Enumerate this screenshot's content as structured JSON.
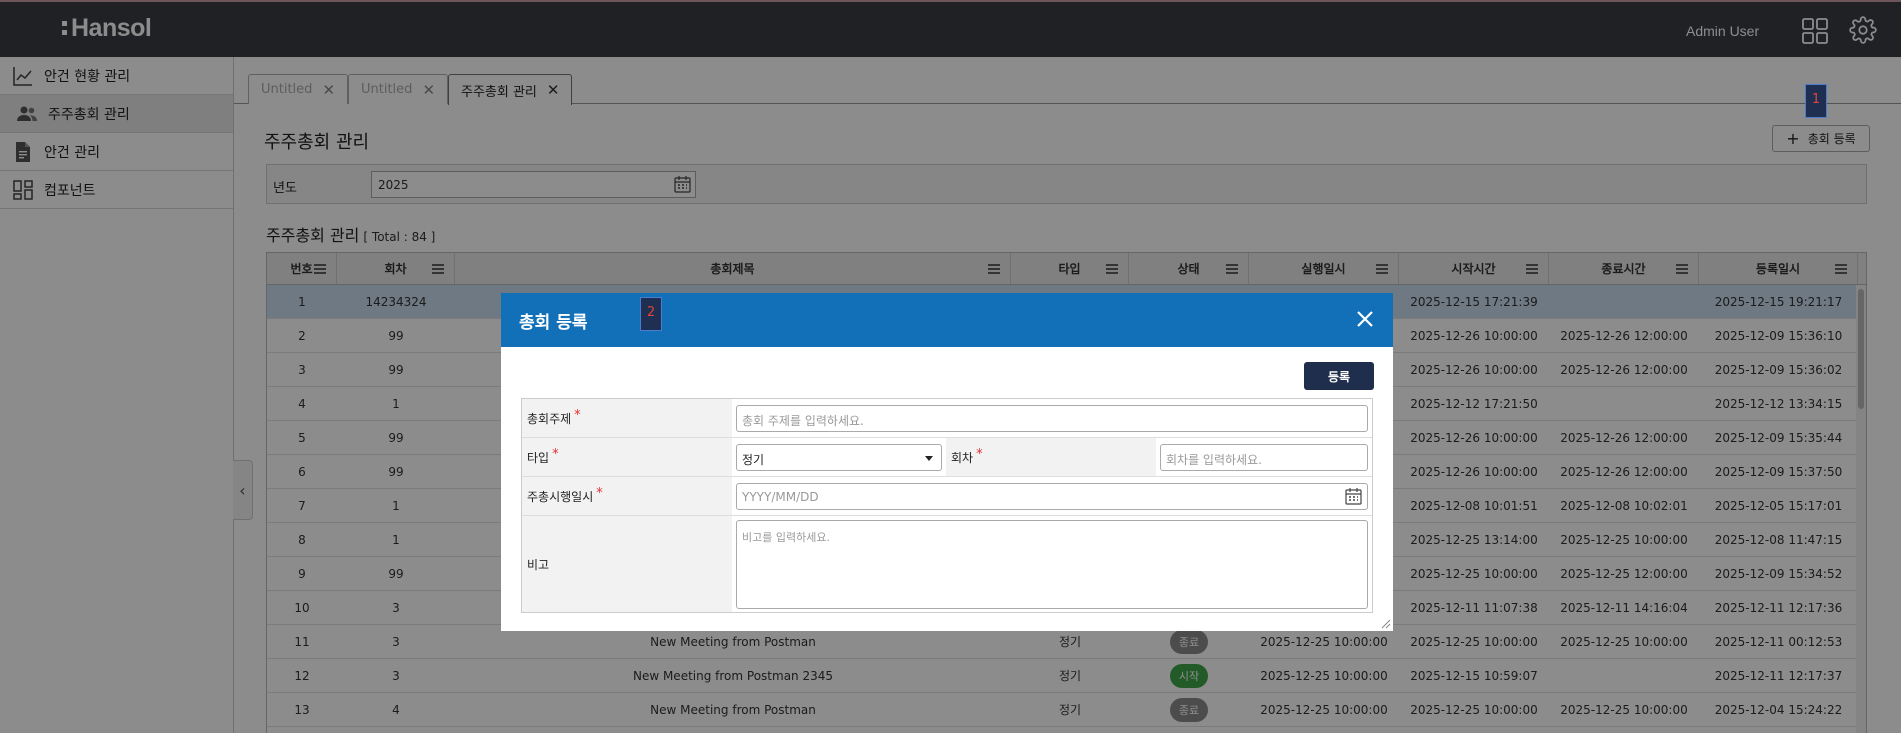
{
  "app": {
    "logo": "Hansol",
    "user": "Admin User"
  },
  "sidebar": {
    "items": [
      {
        "label": "안건 현황 관리",
        "icon": "line-chart-icon"
      },
      {
        "label": "주주총회 관리",
        "icon": "users-icon"
      },
      {
        "label": "안건 관리",
        "icon": "document-icon"
      },
      {
        "label": "컴포넌트",
        "icon": "dashboard-grid-icon"
      }
    ],
    "active_index": 1
  },
  "tabs": [
    {
      "label": "Untitled"
    },
    {
      "label": "Untitled"
    },
    {
      "label": "주주총회 관리"
    }
  ],
  "page": {
    "title": "주주총회 관리",
    "add_button": "총회 등록",
    "filter": {
      "label": "년도",
      "value": "2025"
    },
    "list_title": "주주총회 관리",
    "total_text": "[ Total : 84 ]"
  },
  "grid": {
    "columns": [
      "번호",
      "회차",
      "총회제목",
      "타입",
      "상태",
      "실행일시",
      "시작시간",
      "종료시간",
      "등록일시"
    ],
    "rows": [
      [
        "1",
        "14234324",
        "",
        "",
        "",
        "",
        "2025-12-15 17:21:39",
        "",
        "2025-12-15 19:21:17"
      ],
      [
        "2",
        "99",
        "",
        "",
        "",
        "",
        "2025-12-26 10:00:00",
        "2025-12-26 12:00:00",
        "2025-12-09 15:36:10"
      ],
      [
        "3",
        "99",
        "",
        "",
        "",
        "",
        "2025-12-26 10:00:00",
        "2025-12-26 12:00:00",
        "2025-12-09 15:36:02"
      ],
      [
        "4",
        "1",
        "",
        "",
        "",
        "",
        "2025-12-12 17:21:50",
        "",
        "2025-12-12 13:34:15"
      ],
      [
        "5",
        "99",
        "",
        "",
        "",
        "",
        "2025-12-26 10:00:00",
        "2025-12-26 12:00:00",
        "2025-12-09 15:35:44"
      ],
      [
        "6",
        "99",
        "",
        "",
        "",
        "",
        "2025-12-26 10:00:00",
        "2025-12-26 12:00:00",
        "2025-12-09 15:37:50"
      ],
      [
        "7",
        "1",
        "",
        "",
        "",
        "",
        "2025-12-08 10:01:51",
        "2025-12-08 10:02:01",
        "2025-12-05 15:17:01"
      ],
      [
        "8",
        "1",
        "",
        "",
        "",
        "",
        "2025-12-25 13:14:00",
        "2025-12-25 10:00:00",
        "2025-12-08 11:47:15"
      ],
      [
        "9",
        "99",
        "",
        "",
        "",
        "",
        "2025-12-25 10:00:00",
        "2025-12-25 12:00:00",
        "2025-12-09 15:34:52"
      ],
      [
        "10",
        "3",
        "",
        "",
        "",
        "",
        "2025-12-11 11:07:38",
        "2025-12-11 14:16:04",
        "2025-12-11 12:17:36"
      ],
      [
        "11",
        "3",
        "New Meeting from Postman",
        "정기",
        "종료",
        "2025-12-25 10:00:00",
        "2025-12-25 10:00:00",
        "2025-12-25 10:00:00",
        "2025-12-11 00:12:53"
      ],
      [
        "12",
        "3",
        "New Meeting from Postman 2345",
        "정기",
        "시작",
        "2025-12-25 10:00:00",
        "2025-12-15 10:59:07",
        "",
        "2025-12-11 12:17:37"
      ],
      [
        "13",
        "4",
        "New Meeting from Postman",
        "정기",
        "종료",
        "2025-12-25 10:00:00",
        "2025-12-25 10:00:00",
        "2025-12-25 10:00:00",
        "2025-12-04 15:24:22"
      ]
    ],
    "badge_colors": {
      "종료": "#8a8a8a",
      "시작": "#3fa64a"
    }
  },
  "markers": {
    "first": "1",
    "second": "2"
  },
  "modal": {
    "title": "총회 등록",
    "submit": "등록",
    "fields": {
      "subject_label": "총회주제",
      "subject_placeholder": "총회 주제를 입력하세요.",
      "type_label": "타입",
      "type_value": "정기",
      "round_label": "회차",
      "round_placeholder": "회차를 입력하세요.",
      "date_label": "주총시행일시",
      "date_placeholder": "YYYY/MM/DD",
      "note_label": "비고",
      "note_placeholder": "비고를 입력하세요."
    }
  },
  "colors": {
    "header_bg": "#3a3d44",
    "modal_header": "#1270b8",
    "submit_bg": "#1f2e4d",
    "required": "#e53030"
  }
}
